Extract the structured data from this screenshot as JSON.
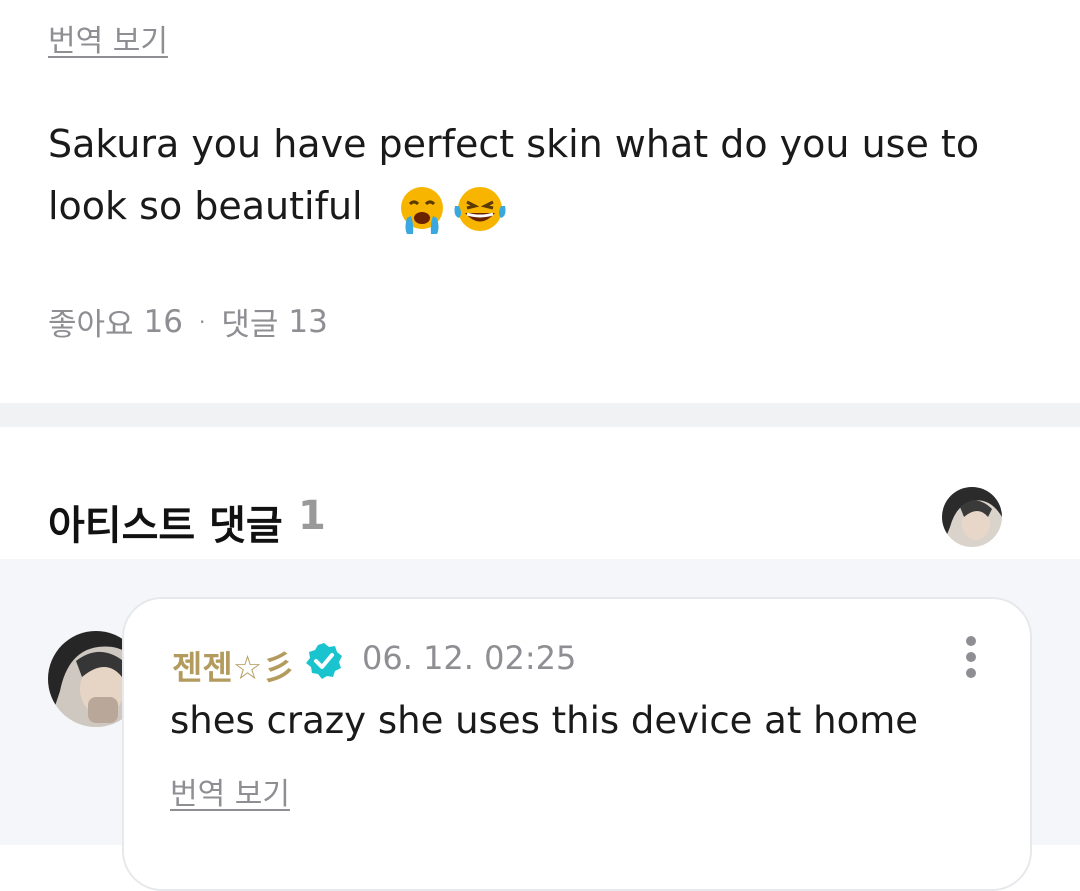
{
  "post": {
    "translate_label": "번역 보기",
    "body_text": "Sakura you have perfect skin what do you use to look so beautiful",
    "emojis": [
      "crying-face-icon",
      "tears-of-joy-icon"
    ],
    "likes_label": "좋아요",
    "likes_count": "16",
    "separator": "·",
    "comments_label": "댓글",
    "comments_count": "13"
  },
  "artist_comments": {
    "title": "아티스트 댓글",
    "count": "1"
  },
  "comment": {
    "author": "젠젠☆彡",
    "timestamp": "06. 12. 02:25",
    "text": "shes crazy she uses this device at home",
    "translate_label": "번역 보기"
  },
  "colors": {
    "author": "#b39a5d",
    "verified": "#19c4cf",
    "muted": "#8e8e93",
    "divider": "#f1f2f4",
    "comment_bg": "#f4f6f9"
  }
}
